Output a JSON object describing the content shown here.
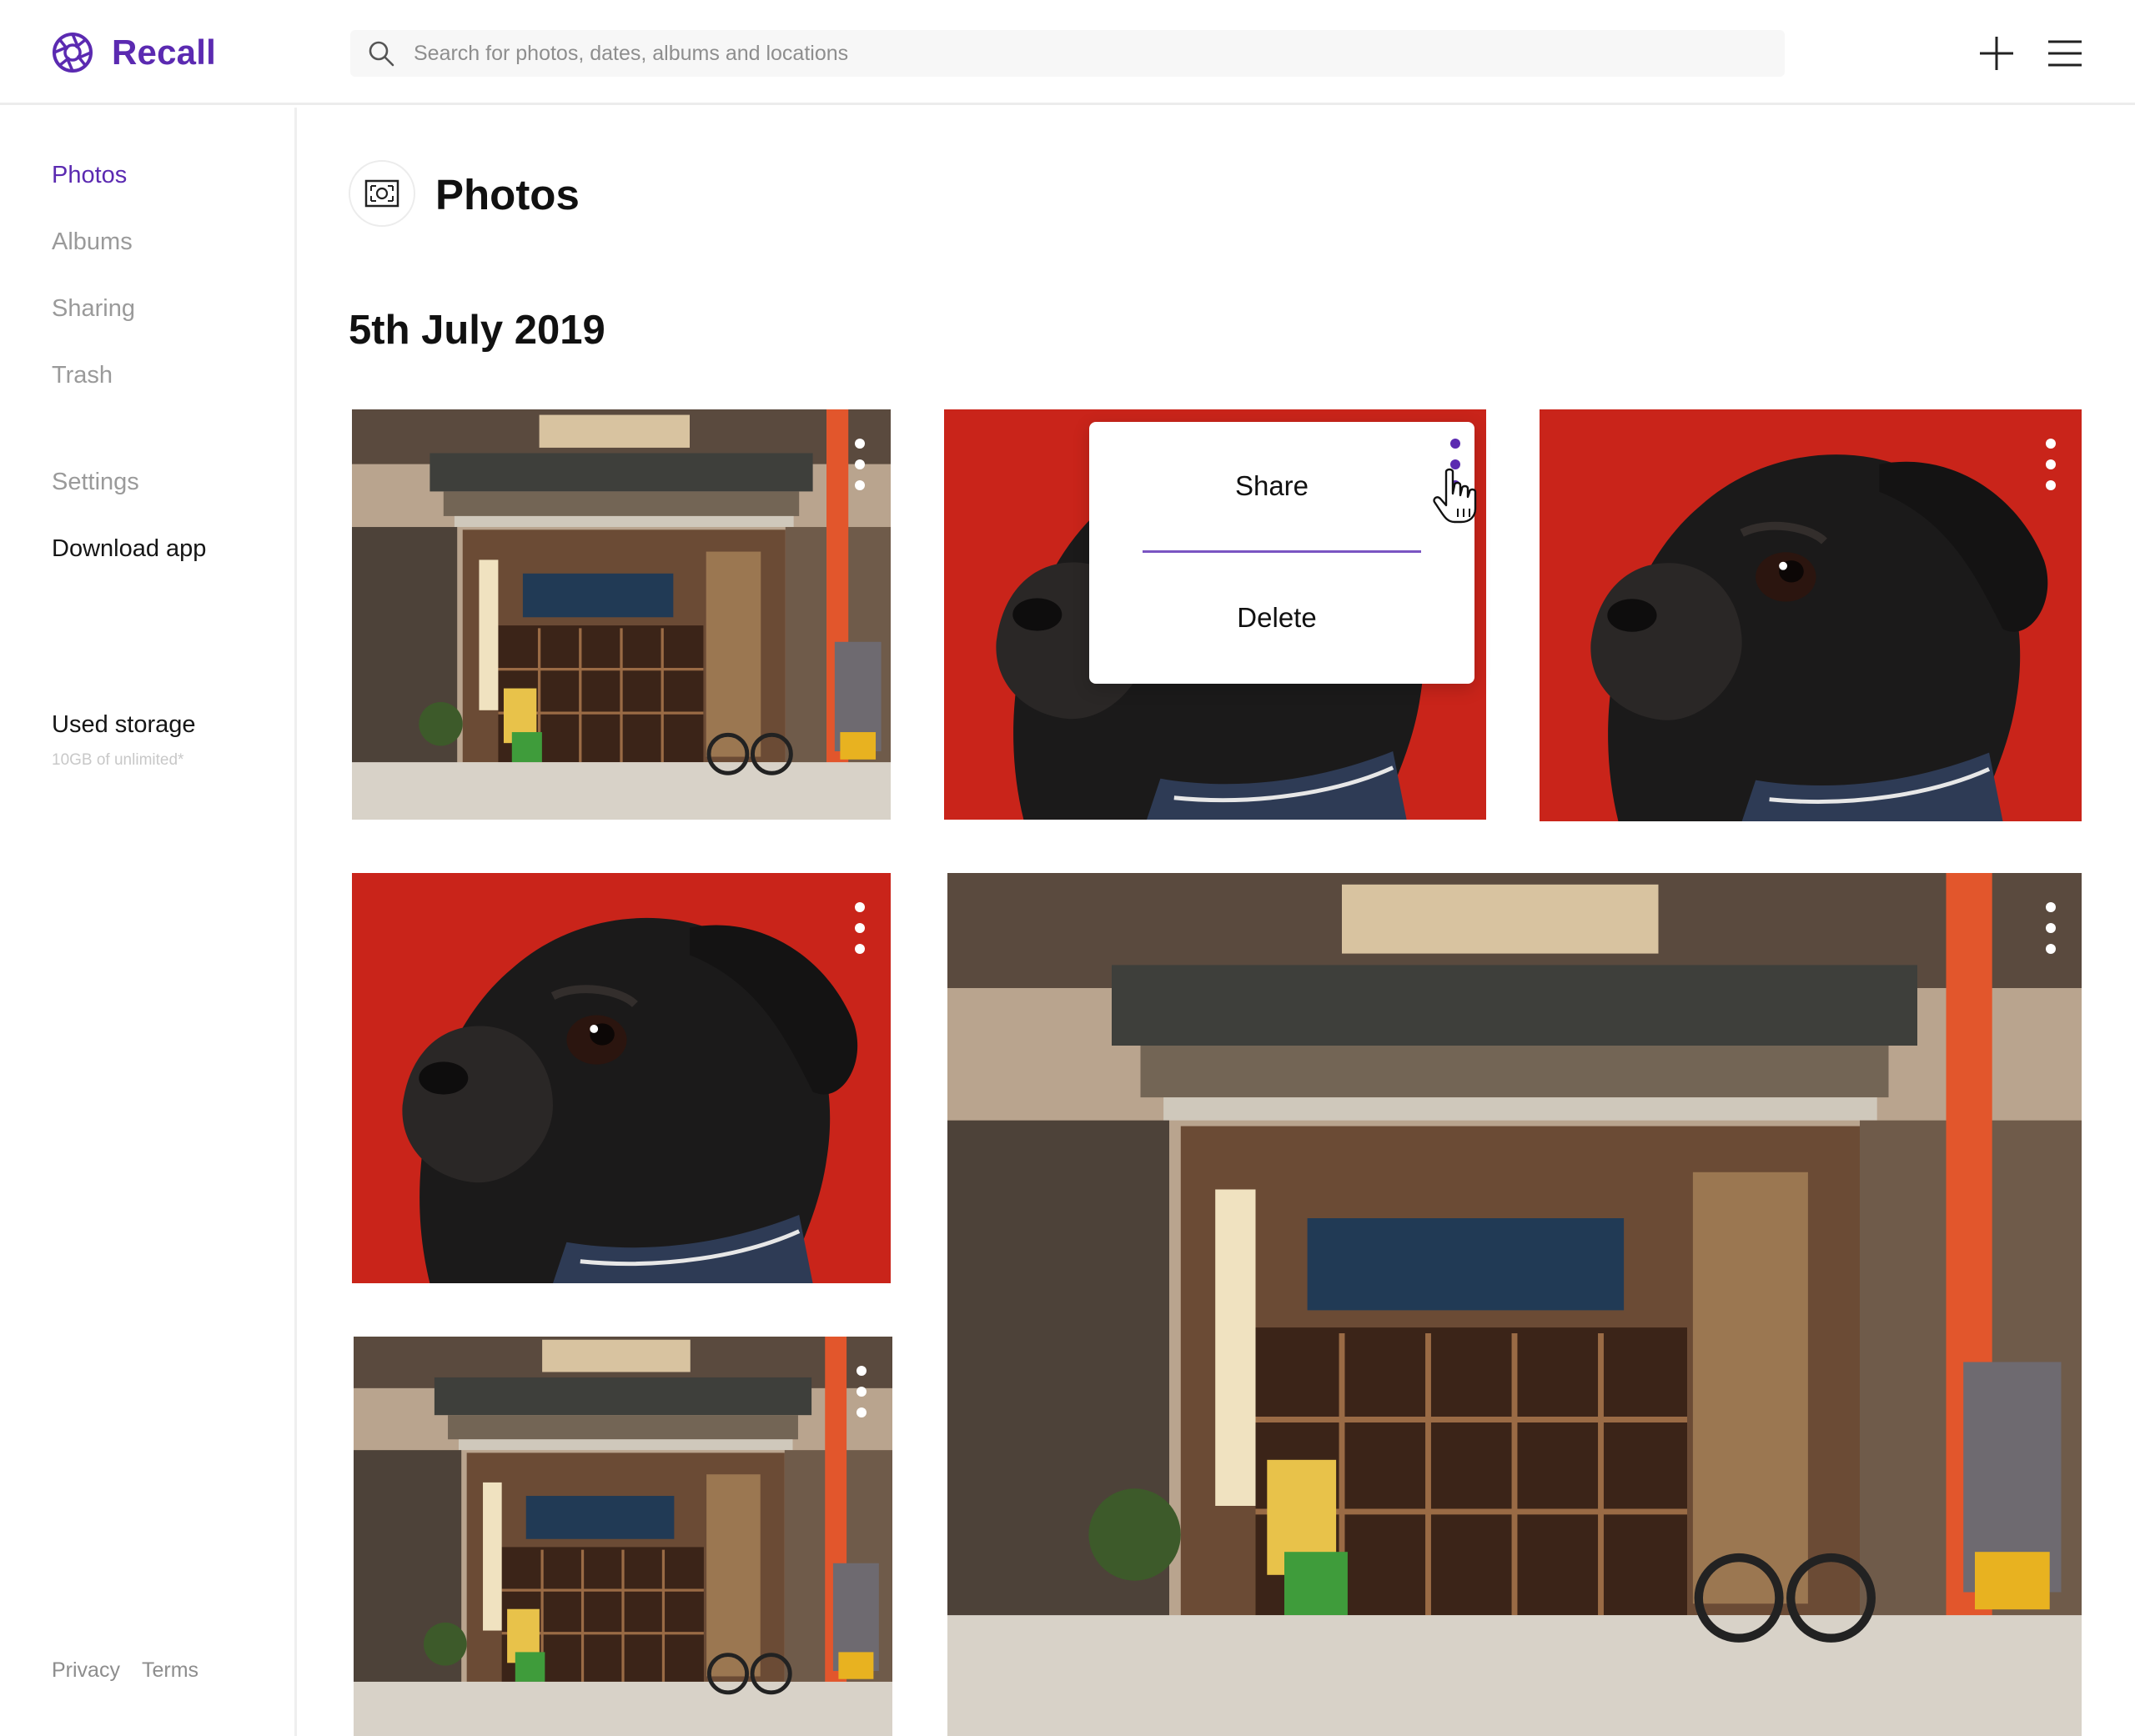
{
  "app": {
    "name": "Recall"
  },
  "search": {
    "placeholder": "Search for photos, dates, albums and locations"
  },
  "header": {
    "add_icon": "plus-icon",
    "menu_icon": "hamburger-menu-icon"
  },
  "sidebar": {
    "items": [
      {
        "label": "Photos",
        "active": true
      },
      {
        "label": "Albums",
        "active": false
      },
      {
        "label": "Sharing",
        "active": false
      },
      {
        "label": "Trash",
        "active": false
      }
    ],
    "settings_label": "Settings",
    "download_label": "Download app",
    "storage": {
      "label": "Used storage",
      "detail": "10GB of unlimited*"
    },
    "footer": {
      "privacy": "Privacy",
      "terms": "Terms"
    }
  },
  "main": {
    "page_title": "Photos",
    "page_icon": "photo-frame-icon",
    "date_heading": "5th July 2019",
    "photos": [
      {
        "subject": "storefront"
      },
      {
        "subject": "pug",
        "menu_open": true
      },
      {
        "subject": "pug"
      },
      {
        "subject": "pug"
      },
      {
        "subject": "storefront"
      },
      {
        "subject": "storefront"
      }
    ]
  },
  "context_menu": {
    "items": [
      "Share",
      "Delete"
    ]
  },
  "colors": {
    "accent": "#5b2ab1",
    "pug_background": "#c9241a",
    "divider": "#7a55c2"
  }
}
